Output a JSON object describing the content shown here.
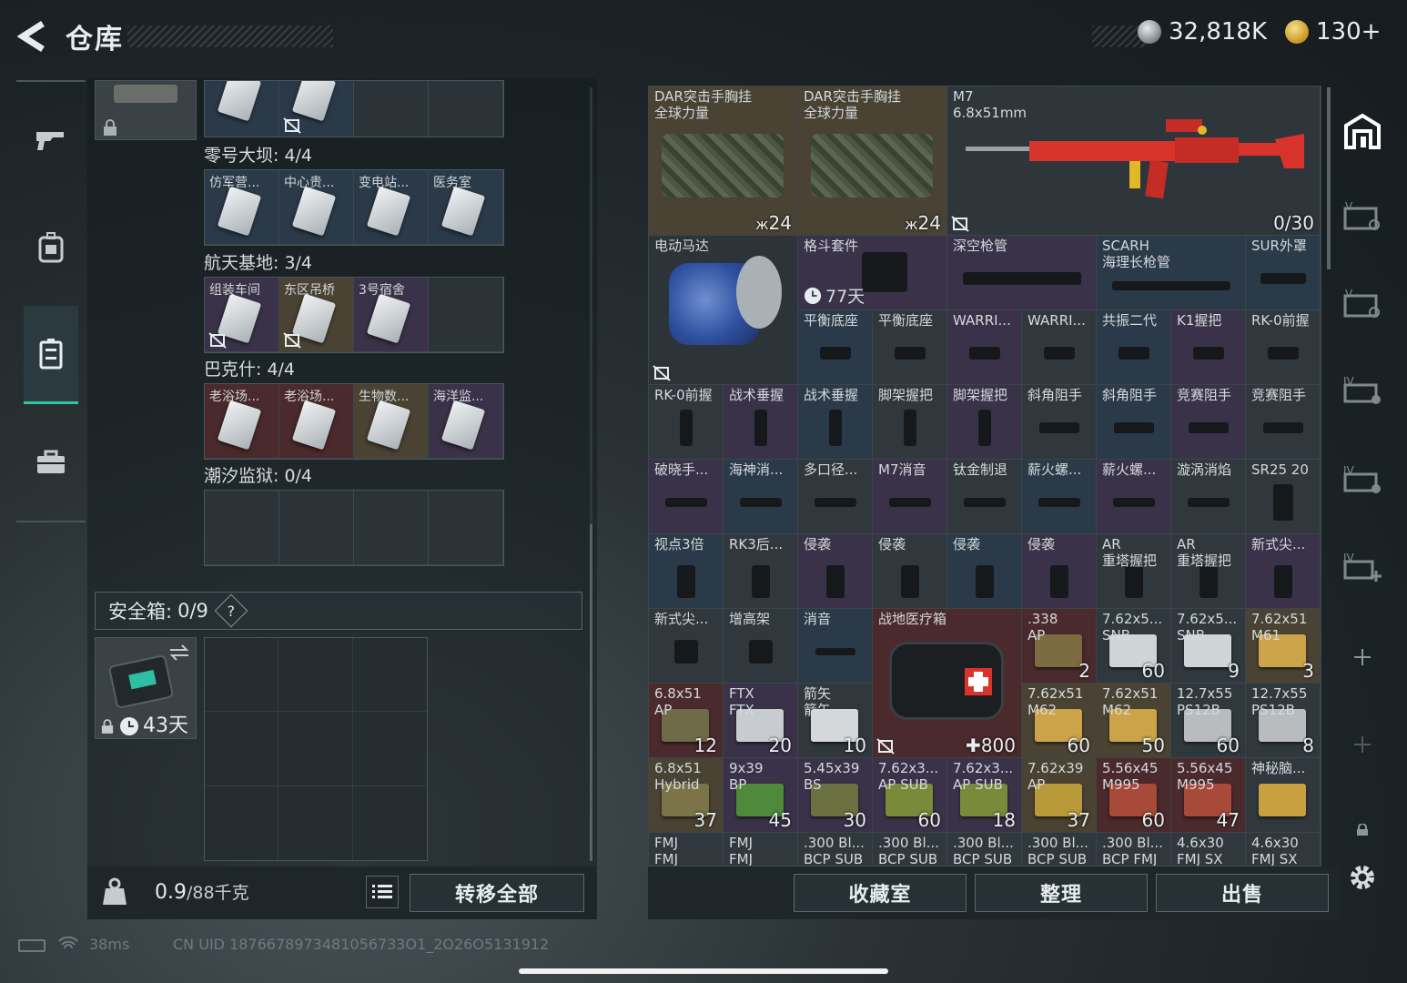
{
  "header": {
    "title": "仓库",
    "currency_silver": "32,818K",
    "currency_gold": "130+"
  },
  "left_nav": {
    "items": [
      {
        "name": "weapons-tab",
        "icon": "gun-icon"
      },
      {
        "name": "gear-tab",
        "icon": "backpack-icon"
      },
      {
        "name": "storage-tab",
        "icon": "locker-icon"
      },
      {
        "name": "toolbox-tab",
        "icon": "briefcase-icon"
      }
    ]
  },
  "keycards": {
    "sections": [
      {
        "title": "零号大坝: 4/4",
        "cards": [
          "仿军营...",
          "中心贵...",
          "变电站...",
          "医务室"
        ]
      },
      {
        "title": "航天基地: 3/4",
        "cards": [
          "组装车间",
          "东区吊桥",
          "3号宿舍",
          ""
        ]
      },
      {
        "title": "巴克什: 4/4",
        "cards": [
          "老浴场...",
          "老浴场...",
          "生物数...",
          "海洋监..."
        ]
      },
      {
        "title": "潮汐监狱: 0/4",
        "cards": [
          "",
          "",
          "",
          ""
        ]
      }
    ]
  },
  "safebox": {
    "label": "安全箱:",
    "count": "0/9",
    "help": "?",
    "timer": "43天"
  },
  "weight": {
    "value": "0.9",
    "capacity": "/88千克",
    "kg_icon_label": "KG"
  },
  "buttons": {
    "transfer_all": "转移全部",
    "collection": "收藏室",
    "organize": "整理",
    "sell": "出售"
  },
  "storage": {
    "bag1": {
      "label1": "DAR突击手胸挂",
      "label2": "全球力量",
      "count": "24"
    },
    "bag2": {
      "label1": "DAR突击手胸挂",
      "label2": "全球力量",
      "count": "24"
    },
    "rifle": {
      "label1": "M7",
      "label2": "6.8x51mm",
      "ammo": "0/30"
    },
    "motor": {
      "label": "电动马达"
    },
    "fight": {
      "label": "格斗套件",
      "timer": "77天"
    },
    "deep": {
      "label": "深空枪管"
    },
    "scarh": {
      "label1": "SCARH",
      "label2": "海理长枪管"
    },
    "sur": {
      "label": "SUR外罩"
    },
    "row_a": [
      "平衡底座",
      "平衡底座",
      "WARRI...",
      "WARRI...",
      "共振二代",
      "K1握把",
      "RK-0前握"
    ],
    "row_b": [
      "RK-0前握",
      "战术垂握",
      "战术垂握",
      "脚架握把",
      "脚架握把",
      "斜角阻手",
      "斜角阻手",
      "竞赛阻手",
      "竞赛阻手"
    ],
    "row_c": [
      "破晓手...",
      "海神消...",
      "多口径...",
      "M7消音",
      "钛金制退",
      "薪火螺...",
      "薪火螺...",
      "漩涡消焰",
      "SR25 20"
    ],
    "row_d": [
      {
        "l1": "视点3倍",
        "l2": ""
      },
      {
        "l1": "RK3后...",
        "l2": ""
      },
      {
        "l1": "侵袭",
        "l2": ""
      },
      {
        "l1": "侵袭",
        "l2": ""
      },
      {
        "l1": "侵袭",
        "l2": ""
      },
      {
        "l1": "侵袭",
        "l2": ""
      },
      {
        "l1": "AR",
        "l2": "重塔握把"
      },
      {
        "l1": "AR",
        "l2": "重塔握把"
      },
      {
        "l1": "新式尖...",
        "l2": ""
      }
    ],
    "row_e_left": [
      "新式尖...",
      "增高架",
      "消音"
    ],
    "medkit": {
      "label": "战地医疗箱",
      "count": "800"
    },
    "row_e_right": [
      {
        "l1": ".338",
        "l2": "AP",
        "c": "2"
      },
      {
        "l1": "7.62x5...",
        "l2": "SNB",
        "c": "60"
      },
      {
        "l1": "7.62x5...",
        "l2": "SNB",
        "c": "9"
      },
      {
        "l1": "7.62x51",
        "l2": "M61",
        "c": "3"
      }
    ],
    "row_f_left": [
      {
        "l1": "6.8x51",
        "l2": "AP",
        "c": "12"
      },
      {
        "l1": "FTX",
        "l2": "FTX",
        "c": "20"
      },
      {
        "l1": "箭矢",
        "l2": "箭矢",
        "c": "10"
      }
    ],
    "row_f_right": [
      {
        "l1": "7.62x51",
        "l2": "M62",
        "c": "60"
      },
      {
        "l1": "7.62x51",
        "l2": "M62",
        "c": "50"
      },
      {
        "l1": "12.7x55",
        "l2": "PS12B",
        "c": "60"
      },
      {
        "l1": "12.7x55",
        "l2": "PS12B",
        "c": "8"
      }
    ],
    "row_g": [
      {
        "l1": "6.8x51",
        "l2": "Hybrid",
        "c": "37"
      },
      {
        "l1": "9x39",
        "l2": "BP",
        "c": "45"
      },
      {
        "l1": "5.45x39",
        "l2": "BS",
        "c": "30"
      },
      {
        "l1": "7.62x3...",
        "l2": "AP SUB",
        "c": "60"
      },
      {
        "l1": "7.62x3...",
        "l2": "AP SUB",
        "c": "18"
      },
      {
        "l1": "7.62x39",
        "l2": "AP",
        "c": "37"
      },
      {
        "l1": "5.56x45",
        "l2": "M995",
        "c": "60"
      },
      {
        "l1": "5.56x45",
        "l2": "M995",
        "c": "47"
      },
      {
        "l1": "神秘脑...",
        "l2": "",
        "c": ""
      }
    ],
    "row_h": [
      {
        "l1": "FMJ",
        "l2": "FMJ"
      },
      {
        "l1": "FMJ",
        "l2": "FMJ"
      },
      {
        "l1": ".300 Bl...",
        "l2": "BCP SUB"
      },
      {
        "l1": ".300 Bl...",
        "l2": "BCP SUB"
      },
      {
        "l1": ".300 Bl...",
        "l2": "BCP SUB"
      },
      {
        "l1": ".300 Bl...",
        "l2": "BCP SUB"
      },
      {
        "l1": ".300 Bl...",
        "l2": "BCP FMJ"
      },
      {
        "l1": "4.6x30",
        "l2": "FMJ SX"
      },
      {
        "l1": "4.6x30",
        "l2": "FMJ SX"
      }
    ]
  },
  "status": {
    "ping": "38ms",
    "uid": "CN UID 1876678973481056733O1_2O26O5131912"
  },
  "colors": {
    "accent": "#2ec4a0",
    "rifle": "#d8342c",
    "rarity_red": "#4a2a2c",
    "rarity_gold": "#4a4232",
    "rarity_purple": "#3a3248",
    "rarity_blue": "#2b3a48"
  }
}
